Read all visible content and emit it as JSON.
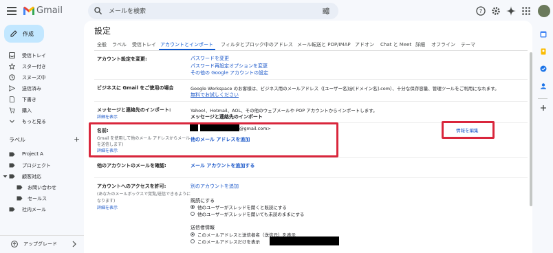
{
  "app": {
    "brand": "Gmail"
  },
  "search": {
    "placeholder": "メールを検索"
  },
  "compose": {
    "label": "作成"
  },
  "nav": [
    {
      "label": "受信トレイ",
      "icon": "inbox-icon"
    },
    {
      "label": "スター付き",
      "icon": "star-icon"
    },
    {
      "label": "スヌーズ中",
      "icon": "clock-icon"
    },
    {
      "label": "送信済み",
      "icon": "send-icon"
    },
    {
      "label": "下書き",
      "icon": "draft-icon"
    },
    {
      "label": "購入",
      "icon": "cart-icon"
    },
    {
      "label": "もっと見る",
      "icon": "chevron-down-icon"
    }
  ],
  "labels": {
    "heading": "ラベル",
    "add": "+",
    "items": [
      {
        "label": "Project A"
      },
      {
        "label": "プロジェクト"
      },
      {
        "label": "顧客対応"
      },
      {
        "label": "お問い合わせ"
      },
      {
        "label": "セールス"
      },
      {
        "label": "社内メール"
      }
    ]
  },
  "upgrade": {
    "label": "アップグレード"
  },
  "settings": {
    "title": "設定",
    "tabs": [
      "全般",
      "ラベル",
      "受信トレイ",
      "アカウントとインポート",
      "フィルタとブロック中のアドレス",
      "メール転送と POP/IMAP",
      "アドオン",
      "Chat と Meet",
      "詳細",
      "オフライン",
      "テーマ"
    ],
    "active_tab": "アカウントとインポート",
    "account_settings": {
      "label": "アカウント設定を変更:",
      "links": [
        "パスワードを変更",
        "パスワード再設定オプションを変更",
        "その他の Google アカウントの設定"
      ]
    },
    "business": {
      "label": "ビジネスに Gmail をご使用の場合",
      "text": "Google Workspace のお客様は、ビジネス用のメールアドレス（[ユーザー名]@[ドメイン名].com）、十分な保存容量、管理ツールをご利用になれます。",
      "link": "無料でお試しください"
    },
    "import": {
      "label": "メッセージと連絡先のインポート:",
      "detail": "詳細を表示",
      "text": "Yahoo!、Hotmail、AOL、その他のウェブメールや POP アカウントからインポートします。",
      "link": "メッセージと連絡先のインポート"
    },
    "name": {
      "label": "名前:",
      "desc1": "Gmail を使用して他のメール アドレスからメール",
      "desc2": "を送信します)",
      "detail": "詳細を表示",
      "email_suffix": "@gmail.com>",
      "add_link": "他のメール アドレスを追加",
      "edit": "情報を編集"
    },
    "check": {
      "label": "他のアカウントのメールを確認:",
      "link": "メール アカウントを追加する"
    },
    "access": {
      "label": "アカウントへのアクセスを許可:",
      "desc1": "(あなたのメールボックスで覚覧/送信できるように",
      "desc2": "なります)",
      "detail": "詳細を表示",
      "link": "別のアカウントを追加",
      "read_heading": "既読にする",
      "read_opt1": "他のユーザーがスレッドを開くと既読にする",
      "read_opt2": "他のユーザーがスレッドを開いても未読のままにする",
      "sender_heading": "送信者情報",
      "sender_opt1": "このメールアドレスと送信者名（送信元）を表示",
      "sender_opt2": "このメールアドレスだけを表示"
    }
  },
  "colors": {
    "accent": "#0b57d0",
    "highlight": "#d9263c",
    "compose": "#c2e7ff"
  }
}
